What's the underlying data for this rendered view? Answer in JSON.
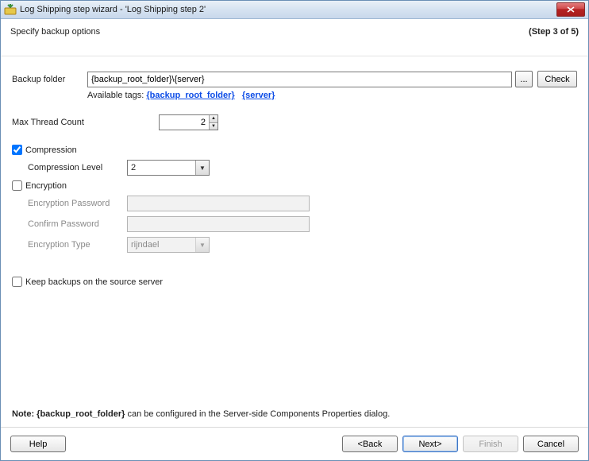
{
  "window": {
    "title": "Log Shipping step wizard - 'Log Shipping step 2'"
  },
  "header": {
    "subtitle": "Specify backup options",
    "step": "(Step 3 of 5)"
  },
  "backup": {
    "label": "Backup folder",
    "value": "{backup_root_folder}\\{server}",
    "browse_label": "...",
    "check_label": "Check",
    "tags_prefix": "Available tags:  ",
    "tag1": "{backup_root_folder}",
    "tag2": "{server}"
  },
  "thread": {
    "label": "Max Thread Count",
    "value": "2"
  },
  "compression": {
    "checkbox_label": "Compression",
    "checked": true,
    "level_label": "Compression Level",
    "level_value": "2"
  },
  "encryption": {
    "checkbox_label": "Encryption",
    "checked": false,
    "password_label": "Encryption Password",
    "password_value": "",
    "confirm_label": "Confirm Password",
    "confirm_value": "",
    "type_label": "Encryption Type",
    "type_value": "rijndael"
  },
  "keep": {
    "label": "Keep backups on the source server",
    "checked": false
  },
  "note": {
    "prefix": "Note:  ",
    "tag": "{backup_root_folder}",
    "suffix": " can be configured in the Server-side Components Properties dialog."
  },
  "footer": {
    "help": "Help",
    "back": "<Back",
    "next": "Next>",
    "finish": "Finish",
    "cancel": "Cancel"
  }
}
